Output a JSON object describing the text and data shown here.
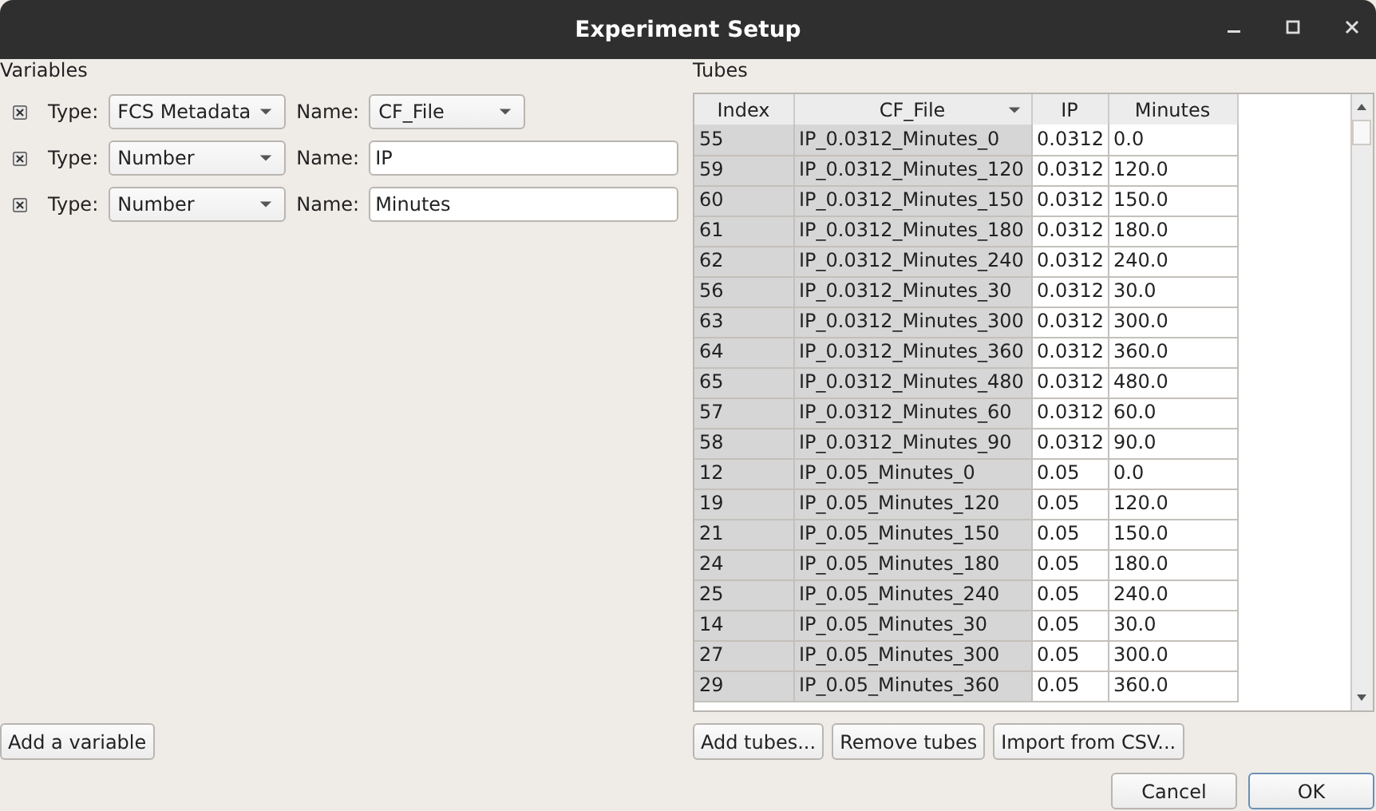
{
  "window": {
    "title": "Experiment Setup"
  },
  "variables": {
    "title": "Variables",
    "items": [
      {
        "kind": "combo",
        "type_label": "Type:",
        "type": "FCS Metadata",
        "name_label": "Name:",
        "name": "CF_File"
      },
      {
        "kind": "text",
        "type_label": "Type:",
        "type": "Number",
        "name_label": "Name:",
        "name": "IP"
      },
      {
        "kind": "text",
        "type_label": "Type:",
        "type": "Number",
        "name_label": "Name:",
        "name": "Minutes"
      }
    ],
    "add_button": "Add a variable"
  },
  "tubes": {
    "title": "Tubes",
    "table": {
      "columns": [
        {
          "label": "Index",
          "editable": false,
          "sorted": false
        },
        {
          "label": "CF_File",
          "editable": false,
          "sorted": true
        },
        {
          "label": "IP",
          "editable": true,
          "sorted": false
        },
        {
          "label": "Minutes",
          "editable": true,
          "sorted": false
        }
      ],
      "rows": [
        [
          "55",
          "IP_0.0312_Minutes_0",
          "0.0312",
          "0.0"
        ],
        [
          "59",
          "IP_0.0312_Minutes_120",
          "0.0312",
          "120.0"
        ],
        [
          "60",
          "IP_0.0312_Minutes_150",
          "0.0312",
          "150.0"
        ],
        [
          "61",
          "IP_0.0312_Minutes_180",
          "0.0312",
          "180.0"
        ],
        [
          "62",
          "IP_0.0312_Minutes_240",
          "0.0312",
          "240.0"
        ],
        [
          "56",
          "IP_0.0312_Minutes_30",
          "0.0312",
          "30.0"
        ],
        [
          "63",
          "IP_0.0312_Minutes_300",
          "0.0312",
          "300.0"
        ],
        [
          "64",
          "IP_0.0312_Minutes_360",
          "0.0312",
          "360.0"
        ],
        [
          "65",
          "IP_0.0312_Minutes_480",
          "0.0312",
          "480.0"
        ],
        [
          "57",
          "IP_0.0312_Minutes_60",
          "0.0312",
          "60.0"
        ],
        [
          "58",
          "IP_0.0312_Minutes_90",
          "0.0312",
          "90.0"
        ],
        [
          "12",
          "IP_0.05_Minutes_0",
          "0.05",
          "0.0"
        ],
        [
          "19",
          "IP_0.05_Minutes_120",
          "0.05",
          "120.0"
        ],
        [
          "21",
          "IP_0.05_Minutes_150",
          "0.05",
          "150.0"
        ],
        [
          "24",
          "IP_0.05_Minutes_180",
          "0.05",
          "180.0"
        ],
        [
          "25",
          "IP_0.05_Minutes_240",
          "0.05",
          "240.0"
        ],
        [
          "14",
          "IP_0.05_Minutes_30",
          "0.05",
          "30.0"
        ],
        [
          "27",
          "IP_0.05_Minutes_300",
          "0.05",
          "300.0"
        ],
        [
          "29",
          "IP_0.05_Minutes_360",
          "0.05",
          "360.0"
        ]
      ]
    },
    "buttons": [
      "Add tubes...",
      "Remove tubes",
      "Import from CSV..."
    ]
  },
  "dialog_buttons": [
    {
      "label": "Cancel",
      "default": false
    },
    {
      "label": "OK",
      "default": true
    }
  ]
}
